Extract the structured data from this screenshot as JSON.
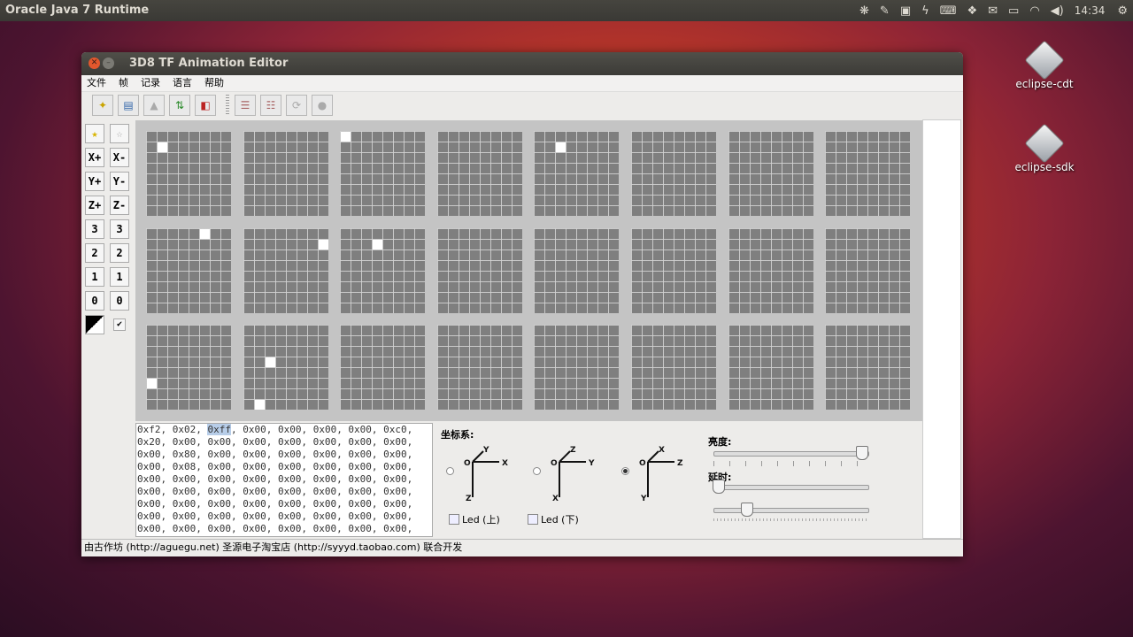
{
  "topbar": {
    "app_title": "Oracle Java 7 Runtime",
    "clock": "14:34"
  },
  "desktop": {
    "icons": [
      {
        "label": "eclipse-cdt"
      },
      {
        "label": "eclipse-sdk"
      }
    ]
  },
  "window": {
    "title": "3D8 TF Animation Editor",
    "menu": [
      "文件",
      "帧",
      "记录",
      "语言",
      "帮助"
    ],
    "left_buttons": [
      "X+",
      "X-",
      "Y+",
      "Y-",
      "Z+",
      "Z-",
      "3",
      "3",
      "2",
      "2",
      "1",
      "1",
      "0",
      "0"
    ],
    "matrices": [
      {
        "lit": [
          [
            1,
            1
          ]
        ]
      },
      {
        "lit": []
      },
      {
        "lit": [
          [
            0,
            0
          ]
        ]
      },
      {
        "lit": []
      },
      {
        "lit": [
          [
            2,
            1
          ]
        ]
      },
      {
        "lit": []
      },
      {
        "lit": []
      },
      {
        "lit": []
      },
      {
        "lit": [
          [
            5,
            0
          ]
        ]
      },
      {
        "lit": [
          [
            7,
            1
          ]
        ]
      },
      {
        "lit": [
          [
            3,
            1
          ]
        ]
      },
      {
        "lit": []
      },
      {
        "lit": []
      },
      {
        "lit": []
      },
      {
        "lit": []
      },
      {
        "lit": []
      },
      {
        "lit": [
          [
            0,
            5
          ]
        ]
      },
      {
        "lit": [
          [
            2,
            3
          ],
          [
            1,
            7
          ]
        ]
      },
      {
        "lit": []
      },
      {
        "lit": []
      },
      {
        "lit": []
      },
      {
        "lit": []
      },
      {
        "lit": []
      },
      {
        "lit": []
      }
    ],
    "hex_lines": [
      "0xf2, 0x02, 0xff, 0x00, 0x00, 0x00, 0x00, 0xc0,",
      "0x20, 0x00, 0x00, 0x00, 0x00, 0x00, 0x00, 0x00,",
      "0x00, 0x80, 0x00, 0x00, 0x00, 0x00, 0x00, 0x00,",
      "0x00, 0x08, 0x00, 0x00, 0x00, 0x00, 0x00, 0x00,",
      "0x00, 0x00, 0x00, 0x00, 0x00, 0x00, 0x00, 0x00,",
      "0x00, 0x00, 0x00, 0x00, 0x00, 0x00, 0x00, 0x00,",
      "0x00, 0x00, 0x00, 0x00, 0x00, 0x00, 0x00, 0x00,",
      "0x00, 0x00, 0x00, 0x00, 0x00, 0x00, 0x00, 0x00,",
      "0x00, 0x00, 0x00, 0x00, 0x00, 0x00, 0x00, 0x00,"
    ],
    "coord_label": "坐标系:",
    "axes": [
      {
        "up": "Y",
        "right": "X",
        "down": "Z",
        "origin": "O",
        "selected": false
      },
      {
        "up": "Z",
        "right": "Y",
        "down": "X",
        "origin": "O",
        "selected": false
      },
      {
        "up": "X",
        "right": "Z",
        "down": "Y",
        "origin": "O",
        "selected": true
      }
    ],
    "led_top": "Led (上)",
    "led_bottom": "Led (下)",
    "brightness_label": "亮度:",
    "delay_label": "延时:",
    "brightness": 1.0,
    "delay": 0.0,
    "speed": 0.2,
    "status": "由古作坊 (http://aguegu.net) 圣源电子淘宝店 (http://syyyd.taobao.com) 联合开发"
  },
  "colors": {
    "lit": "#ffffff",
    "off": "#7f7f7f",
    "grid_bg": "#c4c4c4"
  }
}
